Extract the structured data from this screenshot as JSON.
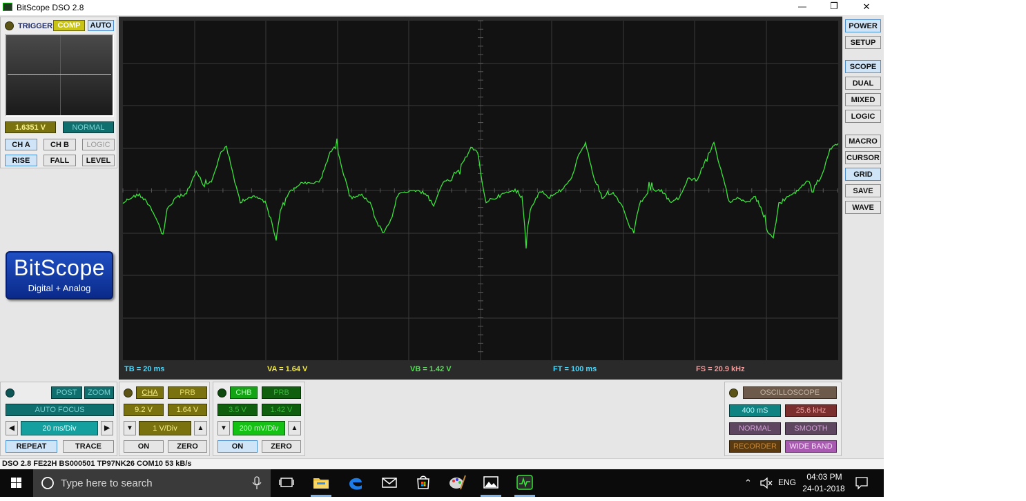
{
  "window": {
    "title": "BitScope DSO 2.8",
    "minimize": "—",
    "maximize": "❐",
    "close": "✕"
  },
  "trigger": {
    "label": "TRIGGER",
    "comp": "COMP",
    "auto": "AUTO",
    "level_value": "1.6351 V",
    "mode": "NORMAL",
    "source_buttons": [
      "CH A",
      "CH B",
      "LOGIC"
    ],
    "edge_buttons": [
      "RISE",
      "FALL",
      "LEVEL"
    ]
  },
  "logo": {
    "brand": "BitScope",
    "tagline": "Digital + Analog"
  },
  "right_buttons": {
    "power": "POWER",
    "setup": "SETUP",
    "scope": "SCOPE",
    "dual": "DUAL",
    "mixed": "MIXED",
    "logic": "LOGIC",
    "macro": "MACRO",
    "cursor": "CURSOR",
    "grid": "GRID",
    "save": "SAVE",
    "wave": "WAVE"
  },
  "readouts": {
    "tb": "TB = 20 ms",
    "va": "VA = 1.64 V",
    "vb": "VB = 1.42 V",
    "ft": "FT = 100 ms",
    "fs": "FS = 20.9 kHz"
  },
  "timebase": {
    "post": "POST",
    "zoom": "ZOOM",
    "auto_focus": "AUTO FOCUS",
    "div": "20 ms/Div",
    "repeat": "REPEAT",
    "trace": "TRACE",
    "left_arrow": "◀",
    "right_arrow": "▶"
  },
  "channel_a": {
    "name": "CHA",
    "probe": "PRB",
    "range": "9.2 V",
    "offset": "1.64 V",
    "div": "1 V/Div",
    "on": "ON",
    "zero": "ZERO",
    "down": "▼",
    "up": "▲"
  },
  "channel_b": {
    "name": "CHB",
    "probe": "PRB",
    "range": "3.5 V",
    "offset": "1.42 V",
    "div": "200 mV/Div",
    "on": "ON",
    "zero": "ZERO",
    "down": "▼",
    "up": "▲"
  },
  "mode_panel": {
    "title": "OSCILLOSCOPE",
    "duration": "400 mS",
    "rate": "25.6 kHz",
    "normal": "NORMAL",
    "smooth": "SMOOTH",
    "recorder": "RECORDER",
    "wide_band": "WIDE BAND"
  },
  "status_bar": {
    "text": "DSO 2.8 FE22H BS000501 TP97NK26 COM10 53 kB/s"
  },
  "taskbar": {
    "search_placeholder": "Type here to search",
    "lang": "ENG",
    "time": "04:03 PM",
    "date": "24-01-2018"
  },
  "colors": {
    "grid_bg": "#121212",
    "trace": "#3be23b",
    "accent_blue": "#cfe4f7",
    "teal": "#0f6f6f",
    "olive": "#7a720e"
  }
}
